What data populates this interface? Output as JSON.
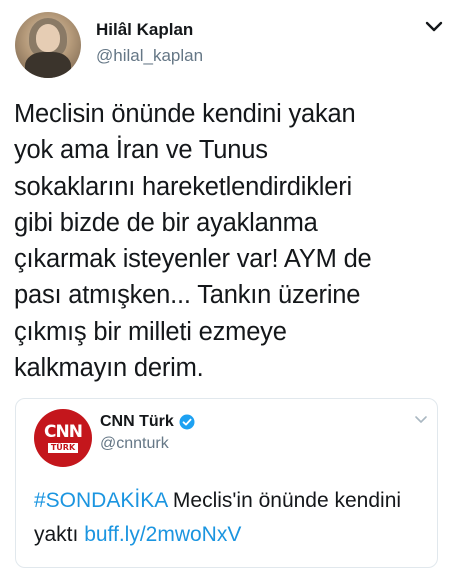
{
  "author": {
    "name": "Hilâl Kaplan",
    "handle": "@hilal_kaplan"
  },
  "tweet": {
    "lines": [
      "Meclisin önünde kendini yakan",
      "yok ama İran ve Tunus",
      "sokaklarını hareketlendirdikleri",
      "gibi bizde de bir ayaklanma",
      "çıkarmak isteyenler var! AYM de",
      "pası atmışken... Tankın üzerine",
      "çıkmış bir milleti ezmeye",
      "kalkmayın derim."
    ]
  },
  "quoted_tweet": {
    "name": "CNN Türk",
    "handle": "@cnnturk",
    "logo": {
      "main": "CNN",
      "sub": "TÜRK"
    },
    "hashtag": "#SONDAKİKA",
    "text_line1": " Meclis'in önünde kendini",
    "text_line2": "yaktı ",
    "link": "buff.ly/2mwoNxV"
  },
  "icons": {
    "menu": "chevron-down-icon",
    "verified": "verified-badge-icon"
  },
  "colors": {
    "link": "#1b95e0",
    "secondary_text": "#657786",
    "verified": "#1da1f2",
    "cnn_red": "#c4161c"
  }
}
